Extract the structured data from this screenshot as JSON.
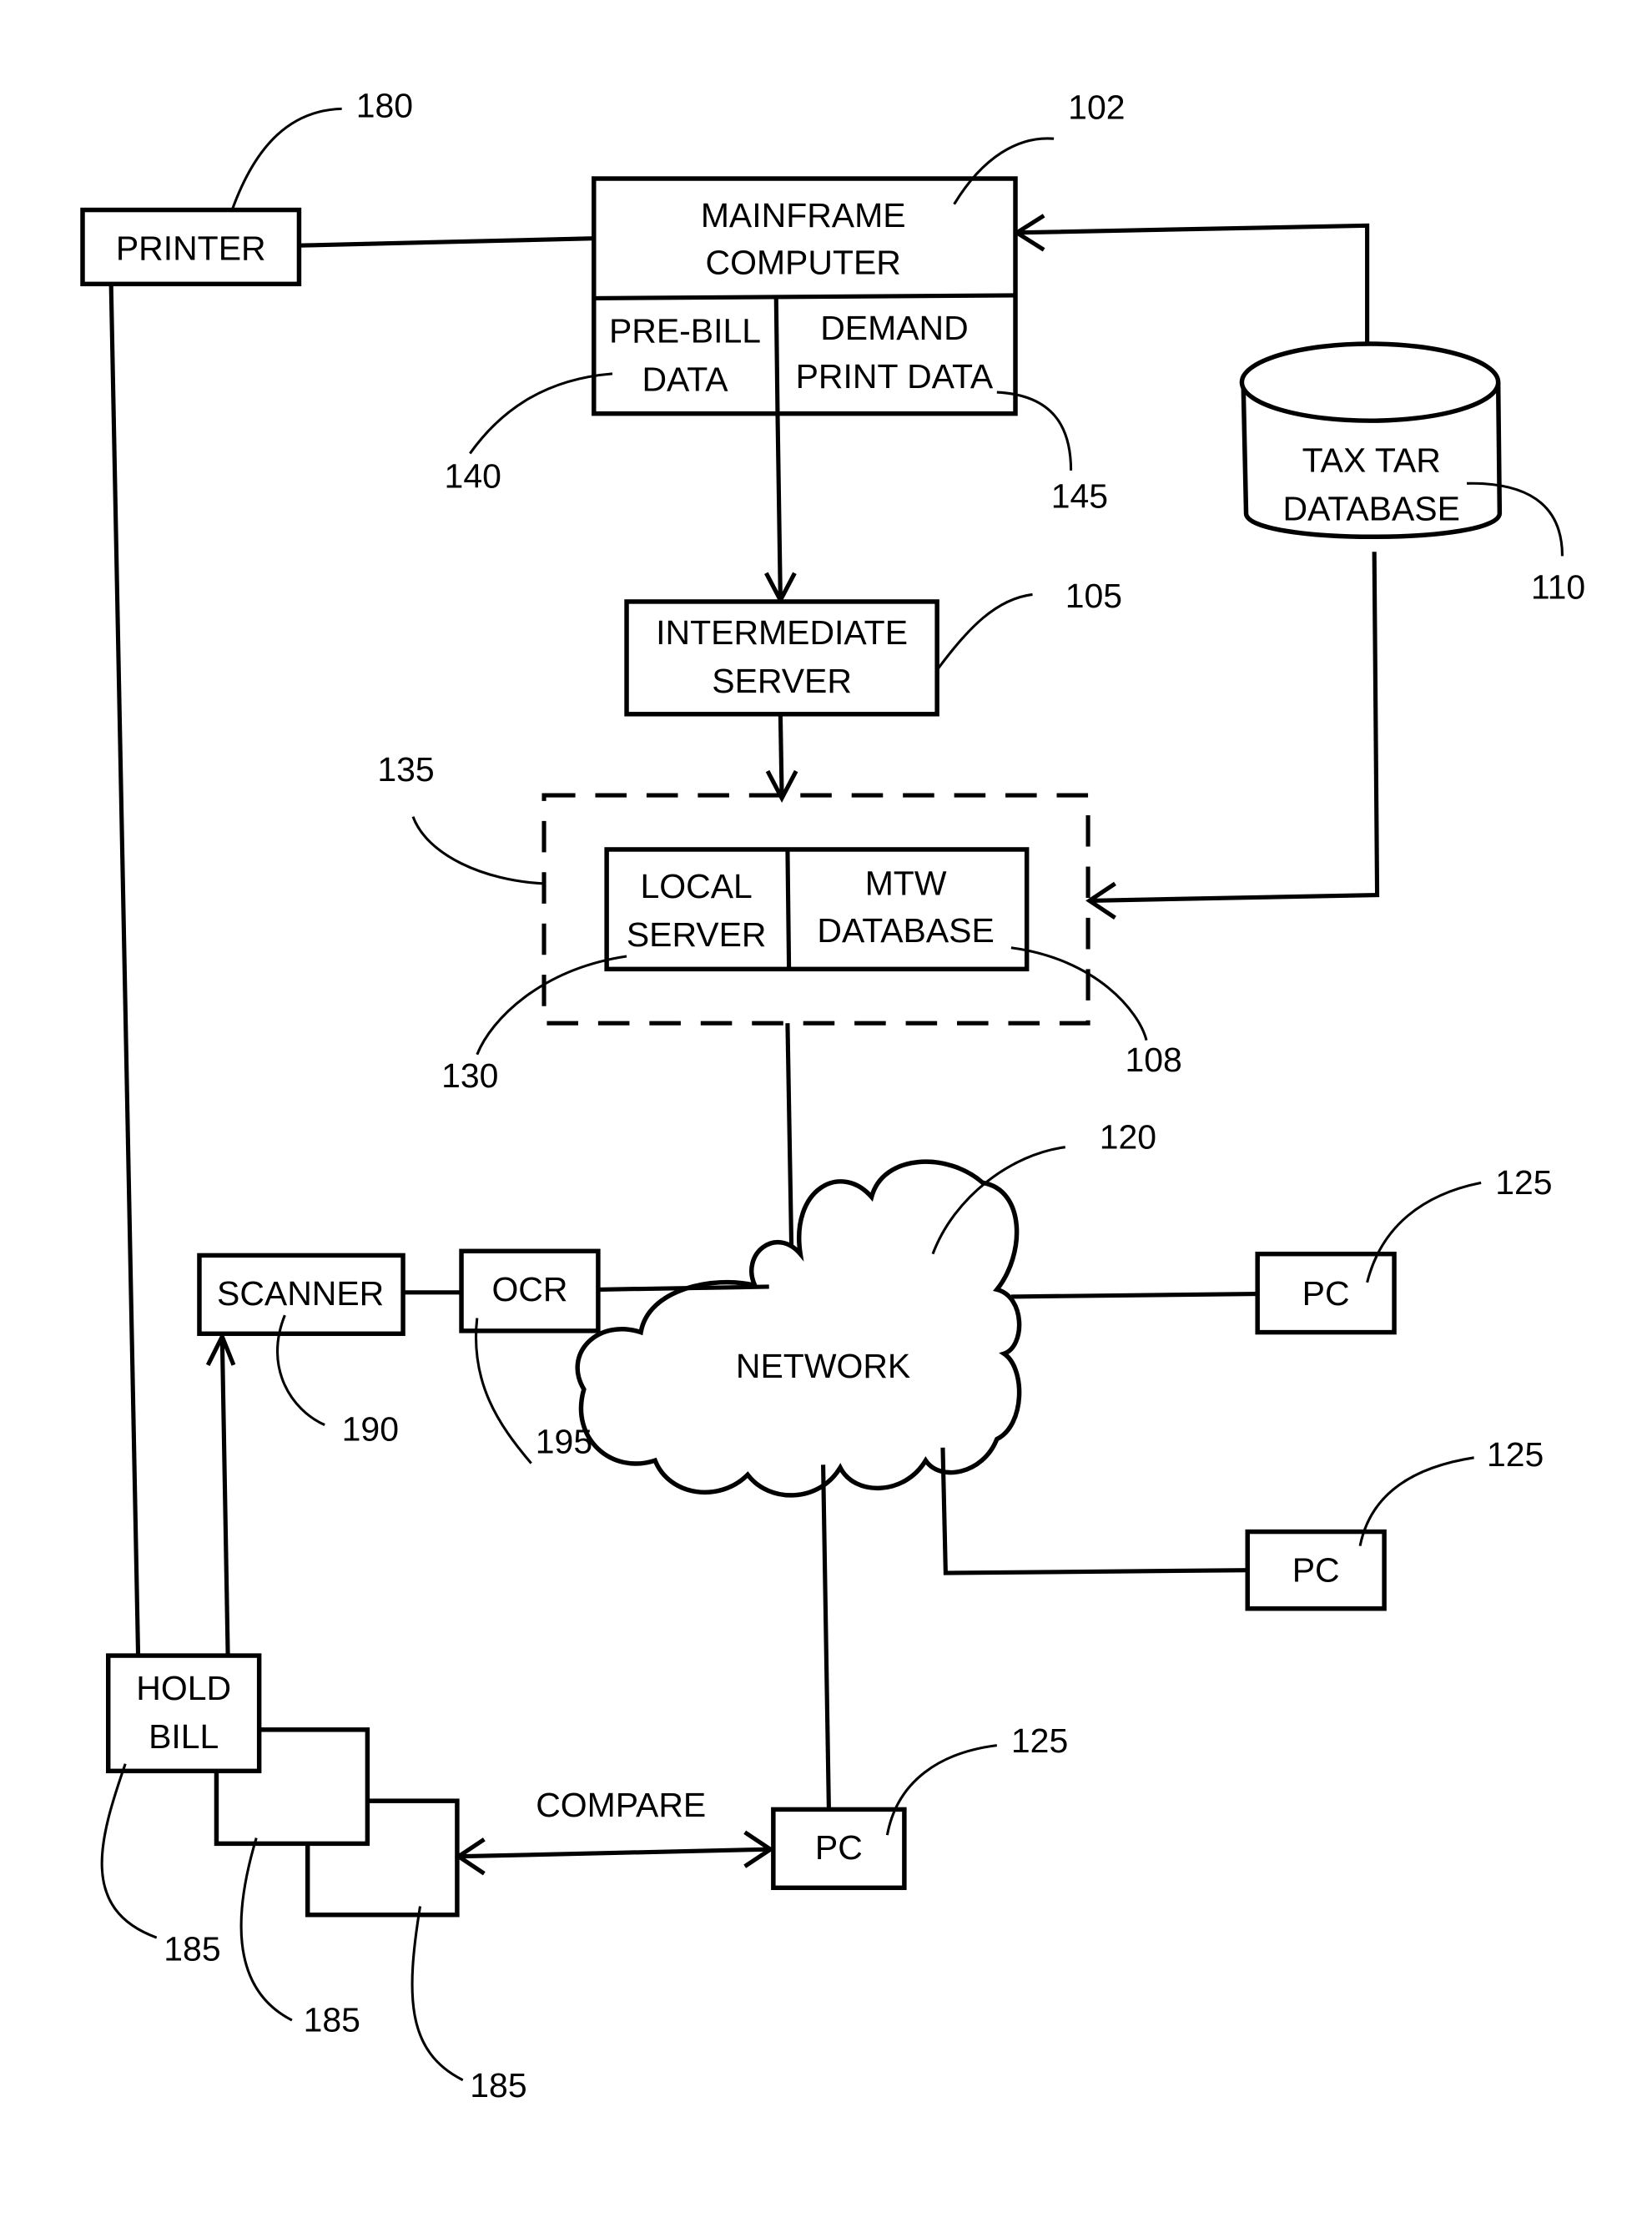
{
  "figure_type": "system block diagram",
  "nodes": {
    "printer": {
      "label": "PRINTER",
      "ref": "180"
    },
    "mainframe": {
      "label_line1": "MAINFRAME",
      "label_line2": "COMPUTER",
      "ref": "102"
    },
    "pre_bill": {
      "label_line1": "PRE-BILL",
      "label_line2": "DATA",
      "ref": "140"
    },
    "demand_print": {
      "label_line1": "DEMAND",
      "label_line2": "PRINT DATA",
      "ref": "145"
    },
    "tax_tar_db": {
      "label_line1": "TAX TAR",
      "label_line2": "DATABASE",
      "ref": "110"
    },
    "intermediate_server": {
      "label_line1": "INTERMEDIATE",
      "label_line2": "SERVER",
      "ref": "105"
    },
    "local_group": {
      "ref": "135"
    },
    "local_server": {
      "label_line1": "LOCAL",
      "label_line2": "SERVER",
      "ref": "130"
    },
    "mtw_db": {
      "label_line1": "MTW",
      "label_line2": "DATABASE",
      "ref": "108"
    },
    "network": {
      "label": "NETWORK",
      "ref": "120"
    },
    "scanner": {
      "label": "SCANNER",
      "ref": "190"
    },
    "ocr": {
      "label": "OCR",
      "ref": "195"
    },
    "pc_1": {
      "label": "PC",
      "ref": "125"
    },
    "pc_2": {
      "label": "PC",
      "ref": "125"
    },
    "pc_3": {
      "label": "PC",
      "ref": "125"
    },
    "hold_bill": {
      "label_line1": "HOLD",
      "label_line2": "BILL",
      "ref": "185"
    },
    "bill_2": {
      "ref": "185"
    },
    "bill_3": {
      "ref": "185"
    }
  },
  "edges": {
    "compare_label": "COMPARE"
  }
}
